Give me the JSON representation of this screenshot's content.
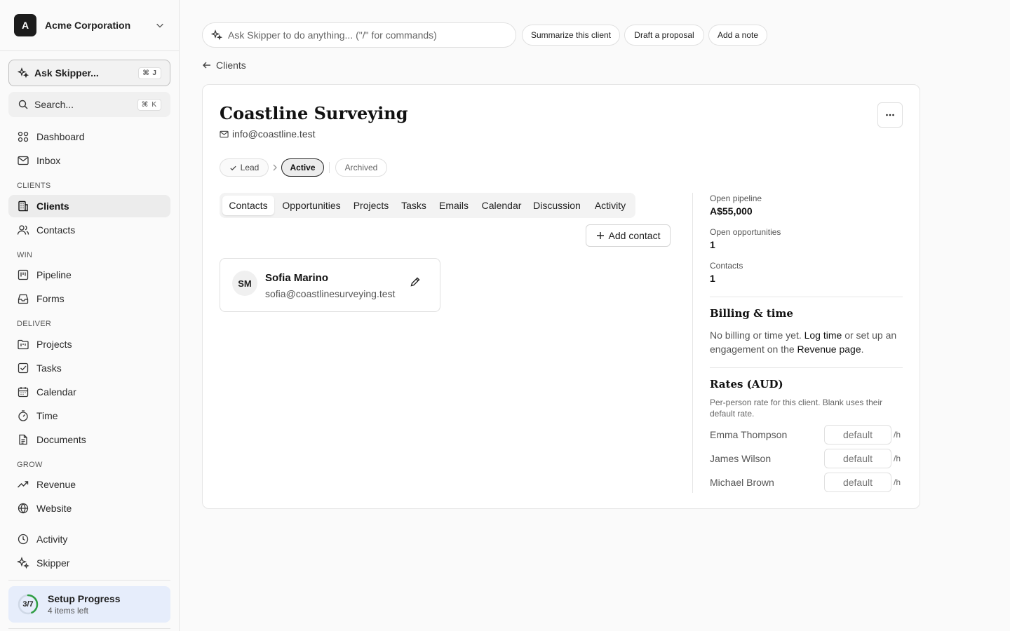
{
  "org": {
    "initial": "A",
    "name": "Acme Corporation"
  },
  "sidebar": {
    "ask_label": "Ask Skipper...",
    "ask_shortcut": "⌘ J",
    "search_label": "Search...",
    "search_shortcut": "⌘ K",
    "items": {
      "dashboard": "Dashboard",
      "inbox": "Inbox",
      "clients": "Clients",
      "contacts": "Contacts",
      "pipeline": "Pipeline",
      "forms": "Forms",
      "projects": "Projects",
      "tasks": "Tasks",
      "calendar": "Calendar",
      "time": "Time",
      "documents": "Documents",
      "revenue": "Revenue",
      "website": "Website",
      "activity": "Activity",
      "skipper": "Skipper"
    },
    "sections": {
      "clients": "CLIENTS",
      "win": "WIN",
      "deliver": "DELIVER",
      "grow": "GROW"
    },
    "setup": {
      "progress": "3/7",
      "completed": 3,
      "total": 7,
      "title": "Setup Progress",
      "subtitle": "4 items left"
    }
  },
  "command_bar": {
    "placeholder": "Ask Skipper to do anything... (\"/\" for commands)",
    "quick_actions": [
      "Summarize this client",
      "Draft a proposal",
      "Add a note"
    ]
  },
  "breadcrumb": {
    "back_label": "Clients"
  },
  "client": {
    "name": "Coastline Surveying",
    "email": "info@coastline.test",
    "stages": {
      "lead": "Lead",
      "active": "Active",
      "archived": "Archived"
    },
    "current_stage": "Active"
  },
  "tabs": [
    "Contacts",
    "Opportunities",
    "Projects",
    "Tasks",
    "Emails",
    "Calendar",
    "Discussion",
    "Activity"
  ],
  "active_tab": "Contacts",
  "add_contact_label": "Add contact",
  "contacts": [
    {
      "initials": "SM",
      "name": "Sofia Marino",
      "email": "sofia@coastlinesurveying.test"
    }
  ],
  "stats": {
    "open_pipeline_label": "Open pipeline",
    "open_pipeline_value": "A$55,000",
    "open_opportunities_label": "Open opportunities",
    "open_opportunities_value": "1",
    "contacts_label": "Contacts",
    "contacts_value": "1"
  },
  "billing": {
    "title": "Billing & time",
    "text_prefix": "No billing or time yet.",
    "log_time": "Log time",
    "text_mid": "or set up an engagement on the",
    "revenue_page": "Revenue page",
    "text_suffix": "."
  },
  "rates": {
    "title": "Rates (AUD)",
    "description": "Per-person rate for this client. Blank uses their default rate.",
    "placeholder": "default",
    "unit": "/h",
    "people": [
      "Emma Thompson",
      "James Wilson",
      "Michael Brown"
    ]
  },
  "colors": {
    "progress_ring": "#2f9e44",
    "setup_bg": "#e6edfb"
  }
}
